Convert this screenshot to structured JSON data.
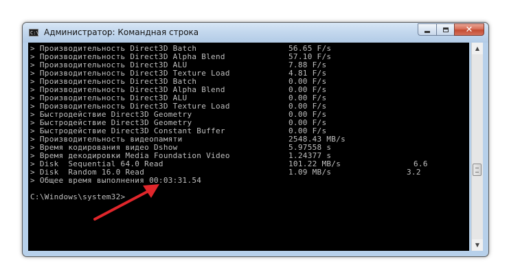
{
  "window": {
    "title": "Администратор: Командная строка",
    "icon_label": "C:\\"
  },
  "controls": {
    "minimize_icon": "minimize-icon",
    "maximize_icon": "maximize-icon",
    "close_icon": "close-icon",
    "close_glyph": "✕"
  },
  "console": {
    "text_color": "#c0c0c0",
    "background": "#000000",
    "lines": [
      {
        "label": "> Производительность Direct3D Batch",
        "value": "56.65 F/s",
        "score": ""
      },
      {
        "label": "> Производительность Direct3D Alpha Blend",
        "value": "57.10 F/s",
        "score": ""
      },
      {
        "label": "> Производительность Direct3D ALU",
        "value": "7.88 F/s",
        "score": ""
      },
      {
        "label": "> Производительность Direct3D Texture Load",
        "value": "4.81 F/s",
        "score": ""
      },
      {
        "label": "> Производительность Direct3D Batch",
        "value": "0.00 F/s",
        "score": ""
      },
      {
        "label": "> Производительность Direct3D Alpha Blend",
        "value": "0.00 F/s",
        "score": ""
      },
      {
        "label": "> Производительность Direct3D ALU",
        "value": "0.00 F/s",
        "score": ""
      },
      {
        "label": "> Производительность Direct3D Texture Load",
        "value": "0.00 F/s",
        "score": ""
      },
      {
        "label": "> Быстродействие Direct3D Geometry",
        "value": "0.00 F/s",
        "score": ""
      },
      {
        "label": "> Быстродействие Direct3D Geometry",
        "value": "0.00 F/s",
        "score": ""
      },
      {
        "label": "> Быстродействие Direct3D Constant Buffer",
        "value": "0.00 F/s",
        "score": ""
      },
      {
        "label": "> Производительность видеопамяти",
        "value": "2548.43 MB/s",
        "score": ""
      },
      {
        "label": "> Время кодирования видео Dshow",
        "value": "5.97558 s",
        "score": ""
      },
      {
        "label": "> Время декодировки Media Foundation Video",
        "value": "1.24377 s",
        "score": ""
      },
      {
        "label": "> Disk  Sequential 64.0 Read",
        "value": "101.22 MB/s",
        "score": "6.6"
      },
      {
        "label": "> Disk  Random 16.0 Read",
        "value": "1.09 MB/s",
        "score": "3.2"
      }
    ],
    "total_line": "> Общее время выполнения 00:03:31.54",
    "prompt": "C:\\Windows\\system32>"
  },
  "scrollbar": {
    "up_icon": "scroll-up-icon",
    "down_icon": "scroll-down-icon",
    "up_glyph": "▲",
    "down_glyph": "▼",
    "position": 0.55
  },
  "annotation": {
    "arrow_color": "#e0262b"
  }
}
